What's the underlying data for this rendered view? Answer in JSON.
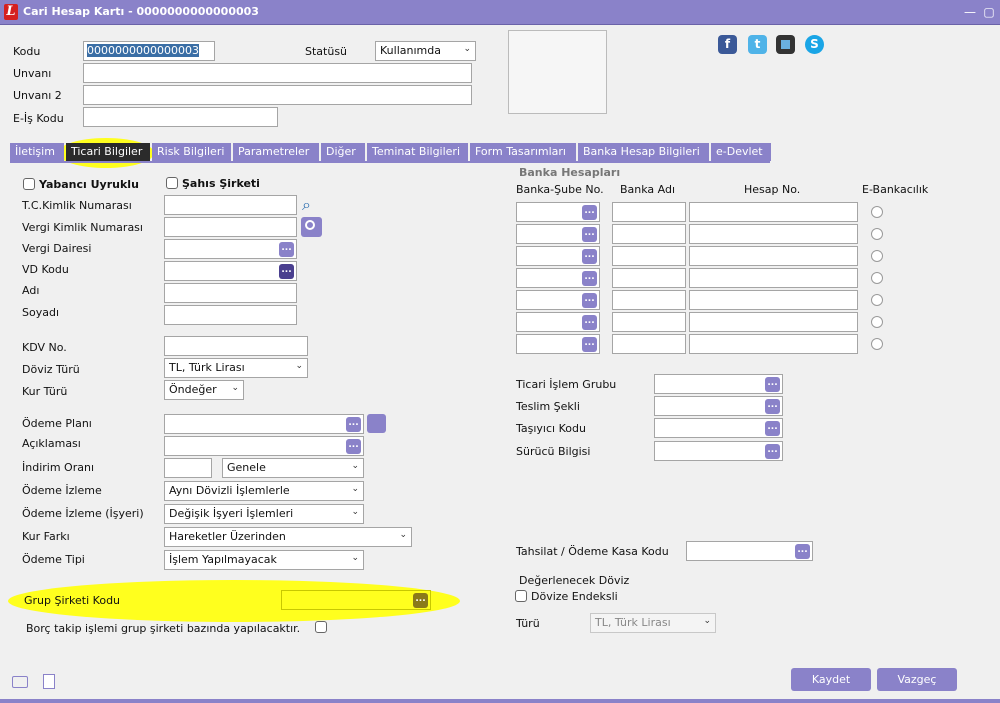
{
  "window": {
    "title": "Cari Hesap Kartı - 0000000000000003"
  },
  "header": {
    "kodu_label": "Kodu",
    "kodu_value": "0000000000000003",
    "statusu_label": "Statüsü",
    "statusu_value": "Kullanımda",
    "unvani_label": "Unvanı",
    "unvani2_label": "Unvanı 2",
    "eis_label": "E-İş Kodu"
  },
  "tabs": [
    "İletişim",
    "Ticari Bilgiler",
    "Risk Bilgileri",
    "Parametreler",
    "Diğer",
    "Teminat Bilgileri",
    "Form Tasarımları",
    "Banka Hesap Bilgileri",
    "e-Devlet"
  ],
  "left": {
    "yabanci": "Yabancı Uyruklu",
    "sahis": "Şahıs Şirketi",
    "tc": "T.C.Kimlik Numarası",
    "vergi_no": "Vergi Kimlik Numarası",
    "vergi_dairesi": "Vergi Dairesi",
    "vd_kodu": "VD Kodu",
    "adi": "Adı",
    "soyadi": "Soyadı",
    "kdv": "KDV No.",
    "doviz_turu": "Döviz Türü",
    "doviz_turu_value": "TL, Türk Lirası",
    "kur_turu": "Kur Türü",
    "kur_turu_value": "Öndeğer",
    "odeme_plani": "Ödeme Planı",
    "aciklamasi": "Açıklaması",
    "indirim_orani": "İndirim Oranı",
    "indirim_value": "Genele",
    "odeme_izleme": "Ödeme İzleme",
    "odeme_izleme_value": "Aynı Dövizli İşlemlerle",
    "odeme_izleme_isyeri": "Ödeme İzleme (İşyeri)",
    "odeme_izleme_isyeri_value": "Değişik İşyeri İşlemleri",
    "kur_farki": "Kur Farkı",
    "kur_farki_value": "Hareketler Üzerinden",
    "odeme_tipi": "Ödeme Tipi",
    "odeme_tipi_value": "İşlem Yapılmayacak",
    "grup_sirketi": "Grup Şirketi Kodu",
    "borc_takip": "Borç takip işlemi grup şirketi bazında yapılacaktır."
  },
  "bank": {
    "section_title": "Banka Hesapları",
    "col_sube": "Banka-Şube No.",
    "col_adi": "Banka Adı",
    "col_hesap": "Hesap No.",
    "col_ebank": "E-Bankacılık",
    "row_count": 7
  },
  "right": {
    "ticari_islem": "Ticari İşlem Grubu",
    "teslim": "Teslim Şekli",
    "tasiyici": "Taşıyıcı Kodu",
    "surucu": "Sürücü Bilgisi",
    "tahsilat": "Tahsilat / Ödeme Kasa Kodu",
    "degerlenecek": "Değerlenecek Döviz",
    "dovize_endeksli": "Dövize Endeksli",
    "turu": "Türü",
    "turu_value": "TL, Türk Lirası"
  },
  "footer": {
    "kaydet": "Kaydet",
    "vazgec": "Vazgeç"
  },
  "icons": {
    "facebook_glyph": "f",
    "twitter_glyph": "t",
    "skype_glyph": "S",
    "dots_glyph": "...",
    "chevron_glyph": "⌄",
    "search_glyph": "⌕"
  },
  "colors": {
    "accent": "#8a82c9",
    "highlight": "#ffff1e",
    "facebook": "#3b5998",
    "twitter": "#4fb3e8",
    "skype": "#1aa5e6"
  }
}
